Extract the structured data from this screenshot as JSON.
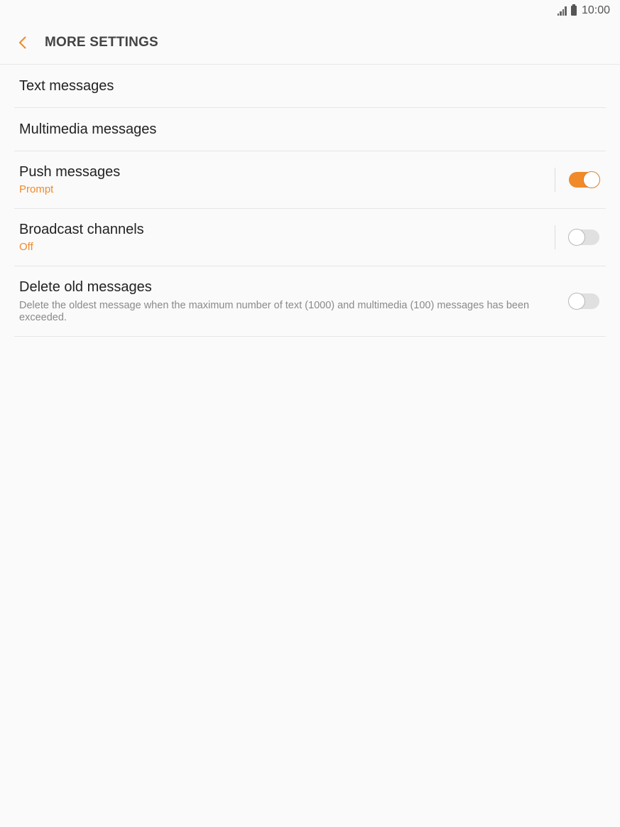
{
  "status": {
    "time": "10:00"
  },
  "header": {
    "title": "MORE SETTINGS"
  },
  "items": [
    {
      "title": "Text messages"
    },
    {
      "title": "Multimedia messages"
    },
    {
      "title": "Push messages",
      "subtitle": "Prompt",
      "toggle": true
    },
    {
      "title": "Broadcast channels",
      "subtitle": "Off",
      "toggle": false
    },
    {
      "title": "Delete old messages",
      "description": "Delete the oldest message when the maximum number of text (1000) and multimedia (100) messages has been exceeded.",
      "toggle": false
    }
  ],
  "colors": {
    "accent": "#f08a2b",
    "background": "#fafafa"
  }
}
